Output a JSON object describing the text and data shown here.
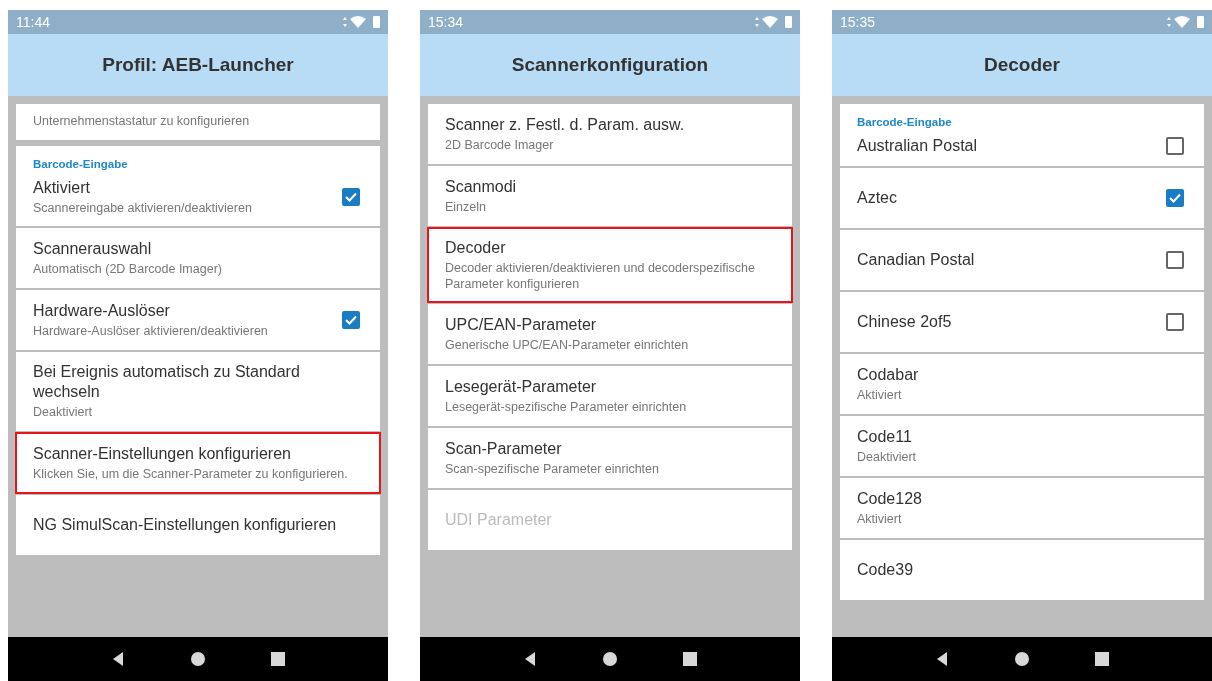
{
  "screens": [
    {
      "time": "11:44",
      "title": "Profil: AEB-Launcher",
      "sections": [
        {
          "items": [
            {
              "kind": "plain",
              "subtitle": "Unternehmenstastatur zu konfigurieren",
              "disabled": false,
              "highlighted": false
            }
          ]
        },
        {
          "header": "Barcode-Eingabe",
          "items": [
            {
              "kind": "checkbox",
              "title": "Aktiviert",
              "subtitle": "Scannereingabe aktivieren/deaktivieren",
              "checked": true,
              "disabled": false,
              "highlighted": false
            },
            {
              "kind": "plain",
              "title": "Scannerauswahl",
              "subtitle": "Automatisch (2D Barcode Imager)",
              "disabled": false,
              "highlighted": false
            },
            {
              "kind": "checkbox",
              "title": "Hardware-Auslöser",
              "subtitle": "Hardware-Auslöser aktivieren/deaktivieren",
              "checked": true,
              "disabled": false,
              "highlighted": false
            },
            {
              "kind": "plain",
              "title": "Bei Ereignis automatisch zu Standard wechseln",
              "subtitle": "Deaktiviert",
              "disabled": false,
              "highlighted": false
            },
            {
              "kind": "plain",
              "title": "Scanner-Einstellungen konfigurieren",
              "subtitle": "Klicken Sie, um die Scanner-Parameter zu konfigurieren.",
              "disabled": false,
              "highlighted": true
            },
            {
              "kind": "plain",
              "title": "NG SimulScan-Einstellungen konfigurieren",
              "disabled": false,
              "highlighted": false
            }
          ]
        }
      ]
    },
    {
      "time": "15:34",
      "title": "Scannerkonfiguration",
      "sections": [
        {
          "items": [
            {
              "kind": "plain",
              "title": "Scanner z. Festl. d. Param. ausw.",
              "subtitle": "2D Barcode Imager",
              "disabled": false,
              "highlighted": false
            },
            {
              "kind": "plain",
              "title": "Scanmodi",
              "subtitle": "Einzeln",
              "disabled": false,
              "highlighted": false
            },
            {
              "kind": "plain",
              "title": "Decoder",
              "subtitle": "Decoder aktivieren/deaktivieren und decoderspezifische Parameter konfigurieren",
              "disabled": false,
              "highlighted": true
            },
            {
              "kind": "plain",
              "title": "UPC/EAN-Parameter",
              "subtitle": "Generische UPC/EAN-Parameter einrichten",
              "disabled": false,
              "highlighted": false
            },
            {
              "kind": "plain",
              "title": "Lesegerät-Parameter",
              "subtitle": "Lesegerät-spezifische Parameter einrichten",
              "disabled": false,
              "highlighted": false
            },
            {
              "kind": "plain",
              "title": "Scan-Parameter",
              "subtitle": "Scan-spezifische Parameter einrichten",
              "disabled": false,
              "highlighted": false
            },
            {
              "kind": "plain",
              "title": "UDI Parameter",
              "disabled": true,
              "highlighted": false
            }
          ]
        }
      ]
    },
    {
      "time": "15:35",
      "title": "Decoder",
      "sections": [
        {
          "header": "Barcode-Eingabe",
          "items": [
            {
              "kind": "checkbox",
              "title": "Australian Postal",
              "checked": false,
              "disabled": false,
              "highlighted": false
            },
            {
              "kind": "checkbox",
              "title": "Aztec",
              "checked": true,
              "disabled": false,
              "highlighted": false
            },
            {
              "kind": "checkbox",
              "title": "Canadian Postal",
              "checked": false,
              "disabled": false,
              "highlighted": false
            },
            {
              "kind": "checkbox",
              "title": "Chinese 2of5",
              "checked": false,
              "disabled": false,
              "highlighted": false
            },
            {
              "kind": "plain",
              "title": "Codabar",
              "subtitle": "Aktiviert",
              "disabled": false,
              "highlighted": false
            },
            {
              "kind": "plain",
              "title": "Code11",
              "subtitle": "Deaktiviert",
              "disabled": false,
              "highlighted": false
            },
            {
              "kind": "plain",
              "title": "Code128",
              "subtitle": "Aktiviert",
              "disabled": false,
              "highlighted": false
            },
            {
              "kind": "plain",
              "title": "Code39",
              "disabled": false,
              "highlighted": false
            }
          ]
        }
      ]
    }
  ]
}
